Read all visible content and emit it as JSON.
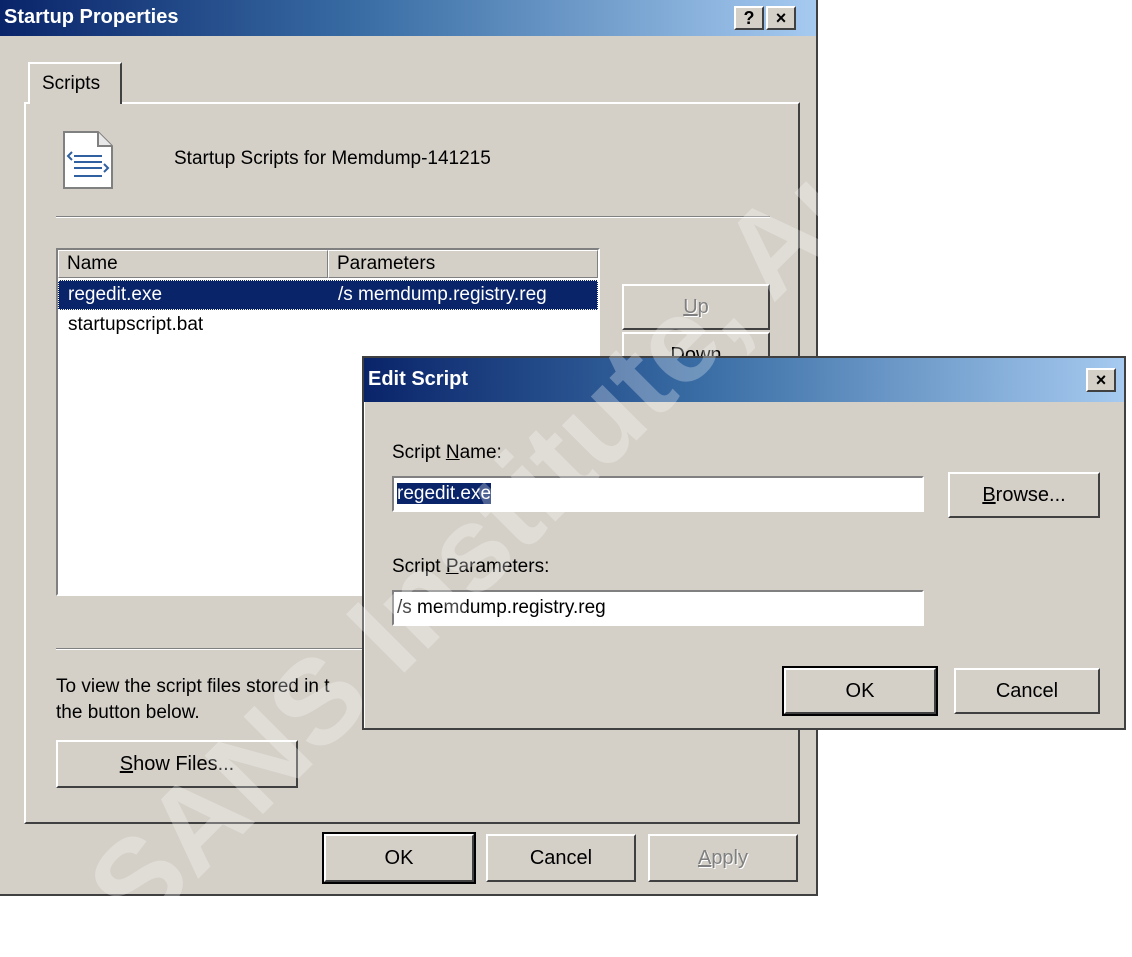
{
  "startup_window": {
    "title": "Startup Properties",
    "help_glyph": "?",
    "close_glyph": "×",
    "tab_label": "Scripts",
    "heading": "Startup Scripts for Memdump-141215",
    "columns": [
      "Name",
      "Parameters"
    ],
    "rows": [
      {
        "name": "regedit.exe",
        "params": "/s memdump.registry.reg",
        "selected": true
      },
      {
        "name": "startupscript.bat",
        "params": "",
        "selected": false
      }
    ],
    "up_prefix": "",
    "up_mnemonic": "U",
    "up_suffix": "p",
    "down_label": "Down",
    "info_line1": "To view the script files stored in t",
    "info_line2": "the button below.",
    "show_mnemonic": "S",
    "show_suffix": "how Files...",
    "ok_label": "OK",
    "cancel_label": "Cancel",
    "apply_mnemonic": "A",
    "apply_suffix": "pply"
  },
  "edit_dialog": {
    "title": "Edit Script",
    "close_glyph": "×",
    "name_label_prefix": "Script ",
    "name_label_mnemonic": "N",
    "name_label_suffix": "ame:",
    "name_value": "regedit.exe",
    "browse_mnemonic": "B",
    "browse_suffix": "rowse...",
    "params_label_prefix": "Script ",
    "params_label_mnemonic": "P",
    "params_label_suffix": "arameters:",
    "params_value": "/s memdump.registry.reg",
    "ok_label": "OK",
    "cancel_label": "Cancel"
  },
  "watermark": "SANS Institute, Author retains full rights",
  "colors": {
    "face": "#d4d0c8",
    "title_start": "#0a246a",
    "title_end": "#a6caf0",
    "selection": "#0a246a"
  }
}
